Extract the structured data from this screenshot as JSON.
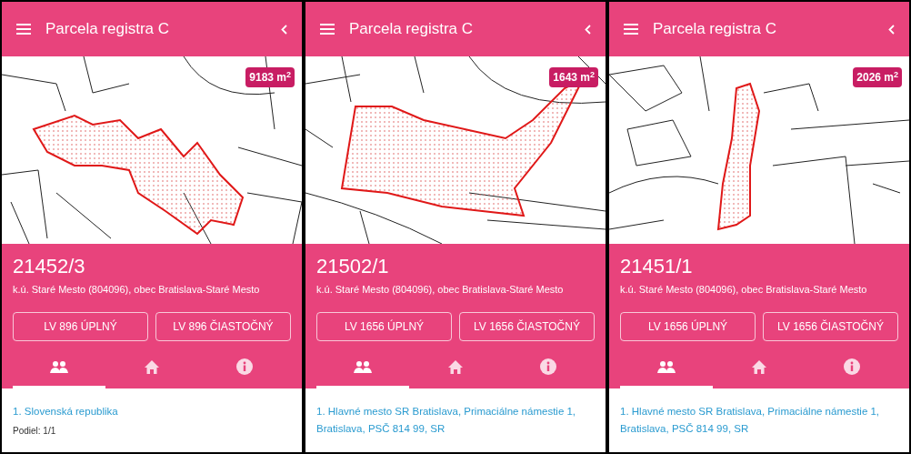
{
  "panels": [
    {
      "title": "Parcela registra C",
      "area": "9183 m$^{2}$",
      "parcel": "21452/3",
      "location": "k.ú. Staré Mesto (804096), obec Bratislava-Staré Mesto",
      "buttons": [
        "LV 896 ÚPLNÝ",
        "LV 896 ČIASTOČNÝ"
      ],
      "tabs": [
        {
          "kind": "owners",
          "selected": true
        },
        {
          "kind": "building",
          "selected": false
        },
        {
          "kind": "info",
          "selected": false
        }
      ],
      "owners": [
        {
          "name": "1. Slovenská republika",
          "share": "Podiel: 1/1"
        }
      ]
    },
    {
      "title": "Parcela registra C",
      "area": "1643 m$^{2}$",
      "parcel": "21502/1",
      "location": "k.ú. Staré Mesto (804096), obec Bratislava-Staré Mesto",
      "buttons": [
        "LV 1656 ÚPLNÝ",
        "LV 1656 ČIASTOČNÝ"
      ],
      "tabs": [
        {
          "kind": "owners",
          "selected": true
        },
        {
          "kind": "building",
          "selected": false
        },
        {
          "kind": "info",
          "selected": false
        }
      ],
      "owners": [
        {
          "name": "1. Hlavné mesto SR Bratislava, Primaciálne námestie 1, Bratislava, PSČ 814 99, SR"
        }
      ]
    },
    {
      "title": "Parcela registra C",
      "area": "2026 m$^{2}$",
      "parcel": "21451/1",
      "location": "k.ú. Staré Mesto (804096), obec Bratislava-Staré Mesto",
      "buttons": [
        "LV 1656 ÚPLNÝ",
        "LV 1656 ČIASTOČNÝ"
      ],
      "tabs": [
        {
          "kind": "owners",
          "selected": true
        },
        {
          "kind": "building",
          "selected": false
        },
        {
          "kind": "info",
          "selected": false
        }
      ],
      "owners": [
        {
          "name": "1. Hlavné mesto SR Bratislava, Primaciálne námestie 1, Bratislava, PSČ 814 99, SR"
        }
      ]
    }
  ]
}
